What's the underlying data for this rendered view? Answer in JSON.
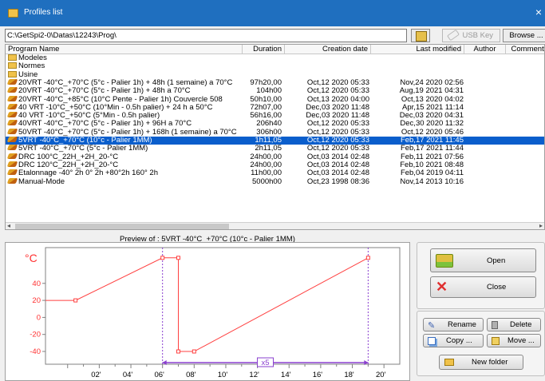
{
  "window": {
    "title": "Profiles list",
    "close_glyph": "×"
  },
  "path": {
    "value": "C:\\GetSpi2-0\\Datas\\12243\\Prog\\"
  },
  "toolbar": {
    "usb_key_label": "USB Key",
    "browse_label": "Browse ..."
  },
  "list": {
    "columns": [
      "Program Name",
      "Duration",
      "Creation date",
      "Last modified",
      "Author",
      "Comments"
    ],
    "folders": [
      "Modeles",
      "Normes",
      "Usine"
    ],
    "programs": [
      {
        "name": "20VRT -40°C_+70°C (5°c - Palier 1h) + 48h (1 semaine) a 70°C",
        "duration": "97h20,00",
        "created": "Oct,12 2020  05:33",
        "modified": "Nov,24 2020  02:56"
      },
      {
        "name": "20VRT -40°C_+70°C (5°c - Palier 1h) + 48h a 70°C",
        "duration": "104h00",
        "created": "Oct,12 2020  05:33",
        "modified": "Aug,19 2021  04:31"
      },
      {
        "name": "20VRT -40°C_+85°C (10°C Pente - Palier 1h) Couvercle 508",
        "duration": "50h10,00",
        "created": "Oct,13 2020  04:00",
        "modified": "Oct,13 2020  04:02"
      },
      {
        "name": "40 VRT -10°C_+50°C (10°Min - 0.5h palier) + 24 h a 50°C",
        "duration": "72h07,00",
        "created": "Dec,03 2020  11:48",
        "modified": "Apr,15 2021  11:14"
      },
      {
        "name": "40 VRT -10°C_+50°C (5°Min - 0.5h palier)",
        "duration": "56h16,00",
        "created": "Dec,03 2020  11:48",
        "modified": "Dec,03 2020  04:31"
      },
      {
        "name": "40VRT -40°C_+70°C (5°c - Palier 1h) + 96H a 70°C",
        "duration": "206h40",
        "created": "Oct,12 2020  05:33",
        "modified": "Dec,30 2020  11:32"
      },
      {
        "name": "50VRT -40°C_+70°C (5°c - Palier 1h) + 168h (1 semaine) a 70°C",
        "duration": "306h00",
        "created": "Oct,12 2020  05:33",
        "modified": "Oct,12 2020  05:46"
      },
      {
        "name": "5VRT -40°C_+70°C (10°c - Palier 1MM)",
        "duration": "1h11,05",
        "created": "Oct,12 2020  05:33",
        "modified": "Feb,17 2021  11:45",
        "selected": true
      },
      {
        "name": "5VRT -40°C_+70°C (5°c - Palier 1MM)",
        "duration": "2h11,05",
        "created": "Oct,12 2020  05:33",
        "modified": "Feb,17 2021  11:44"
      },
      {
        "name": "DRC 100°C_22H_+2H_20-°C",
        "duration": "24h00,00",
        "created": "Oct,03 2014  02:48",
        "modified": "Feb,11 2021  07:56"
      },
      {
        "name": "DRC 120°C_22H_+2H_20-°C",
        "duration": "24h00,00",
        "created": "Oct,03 2014  02:48",
        "modified": "Feb,10 2021  08:48"
      },
      {
        "name": "Etalonnage -40° 2h  0° 2h  +80°2h  160° 2h",
        "duration": "11h00,00",
        "created": "Oct,03 2014  02:48",
        "modified": "Feb,04 2019  04:11"
      },
      {
        "name": "Manual-Mode",
        "duration": "5000h00",
        "created": "Oct,23 1998  08:36",
        "modified": "Nov,14 2013  10:16"
      }
    ]
  },
  "preview": {
    "title": "Preview of :  5VRT -40°C_+70°C (10°c - Palier 1MM)"
  },
  "chart_data": {
    "type": "line",
    "ylabel": "°C",
    "yticks": [
      40,
      20,
      0,
      -20,
      -40
    ],
    "ylim": [
      -55,
      82
    ],
    "xticks": [
      "02'",
      "04'",
      "06'",
      "08'",
      "10'",
      "12'",
      "14'",
      "16'",
      "18'",
      "20'"
    ],
    "xlim": [
      -1.4,
      21
    ],
    "zoom_label": "x5",
    "colors": {
      "line": "#ff4040",
      "marker_line": "#8a3fcf",
      "axis_label": "#ff3030"
    },
    "series": [
      {
        "x": [
          -1.4,
          0.5,
          6.0,
          7.0,
          7.0,
          8.0,
          19.0
        ],
        "y": [
          20,
          20,
          70,
          70,
          -40,
          -40,
          70
        ]
      }
    ],
    "zoom_range": [
      6.0,
      19.0
    ]
  },
  "actions": {
    "open_label": "Open",
    "close_label": "Close",
    "rename_label": "Rename",
    "delete_label": "Delete",
    "copy_label": "Copy ...",
    "move_label": "Move ...",
    "new_folder_label": "New folder"
  }
}
